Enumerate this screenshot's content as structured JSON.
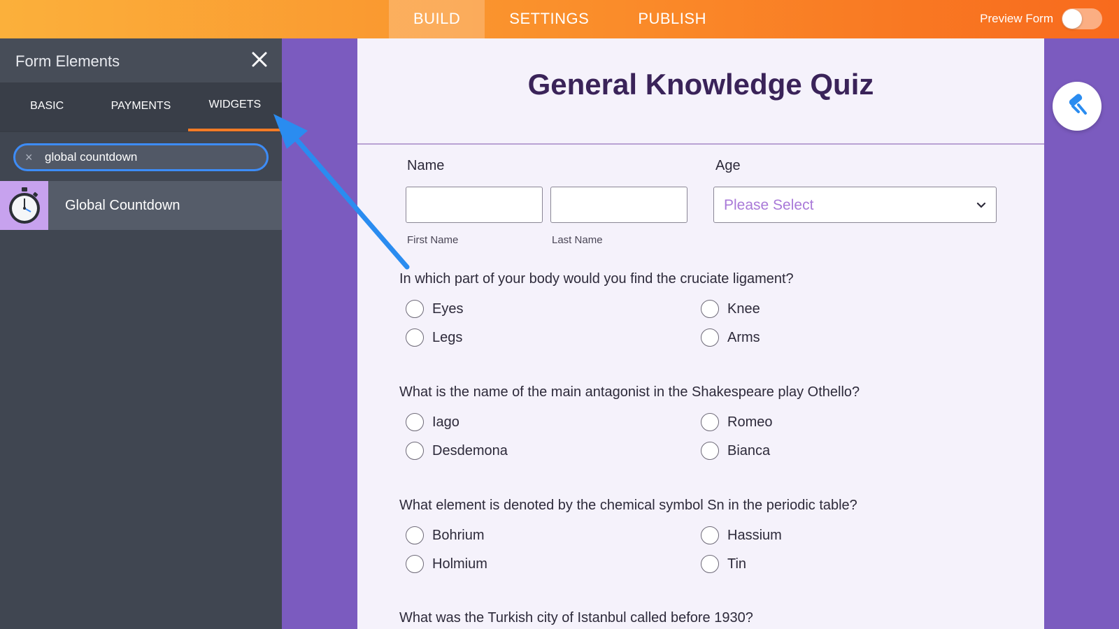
{
  "topbar": {
    "tabs": [
      {
        "label": "BUILD",
        "active": true
      },
      {
        "label": "SETTINGS",
        "active": false
      },
      {
        "label": "PUBLISH",
        "active": false
      }
    ],
    "preview_label": "Preview Form",
    "preview_on": false
  },
  "panel": {
    "title": "Form Elements",
    "tabs": [
      {
        "label": "BASIC",
        "active": false
      },
      {
        "label": "PAYMENTS",
        "active": false
      },
      {
        "label": "WIDGETS",
        "active": true
      }
    ],
    "search": {
      "value": "global countdown",
      "clear_icon": "×"
    },
    "results": [
      {
        "label": "Global Countdown",
        "icon": "stopwatch-icon"
      }
    ]
  },
  "form": {
    "title": "General Knowledge Quiz",
    "name_label": "Name",
    "first_name_sub": "First Name",
    "last_name_sub": "Last Name",
    "age_label": "Age",
    "age_placeholder": "Please Select",
    "questions": [
      {
        "text": "In which part of your body would you find the cruciate ligament?",
        "options": [
          "Eyes",
          "Knee",
          "Legs",
          "Arms"
        ]
      },
      {
        "text": "What is the name of the main antagonist in the Shakespeare play Othello?",
        "options": [
          "Iago",
          "Romeo",
          "Desdemona",
          "Bianca"
        ]
      },
      {
        "text": "What element is denoted by the chemical symbol Sn in the periodic table?",
        "options": [
          "Bohrium",
          "Hassium",
          "Holmium",
          "Tin"
        ]
      },
      {
        "text": "What was the Turkish city of Istanbul called before 1930?",
        "options": []
      }
    ]
  },
  "colors": {
    "accent": "#f37b26",
    "purple_bg": "#7b5bbf",
    "search_border": "#3d8cf7",
    "arrow": "#2a8cf0"
  }
}
